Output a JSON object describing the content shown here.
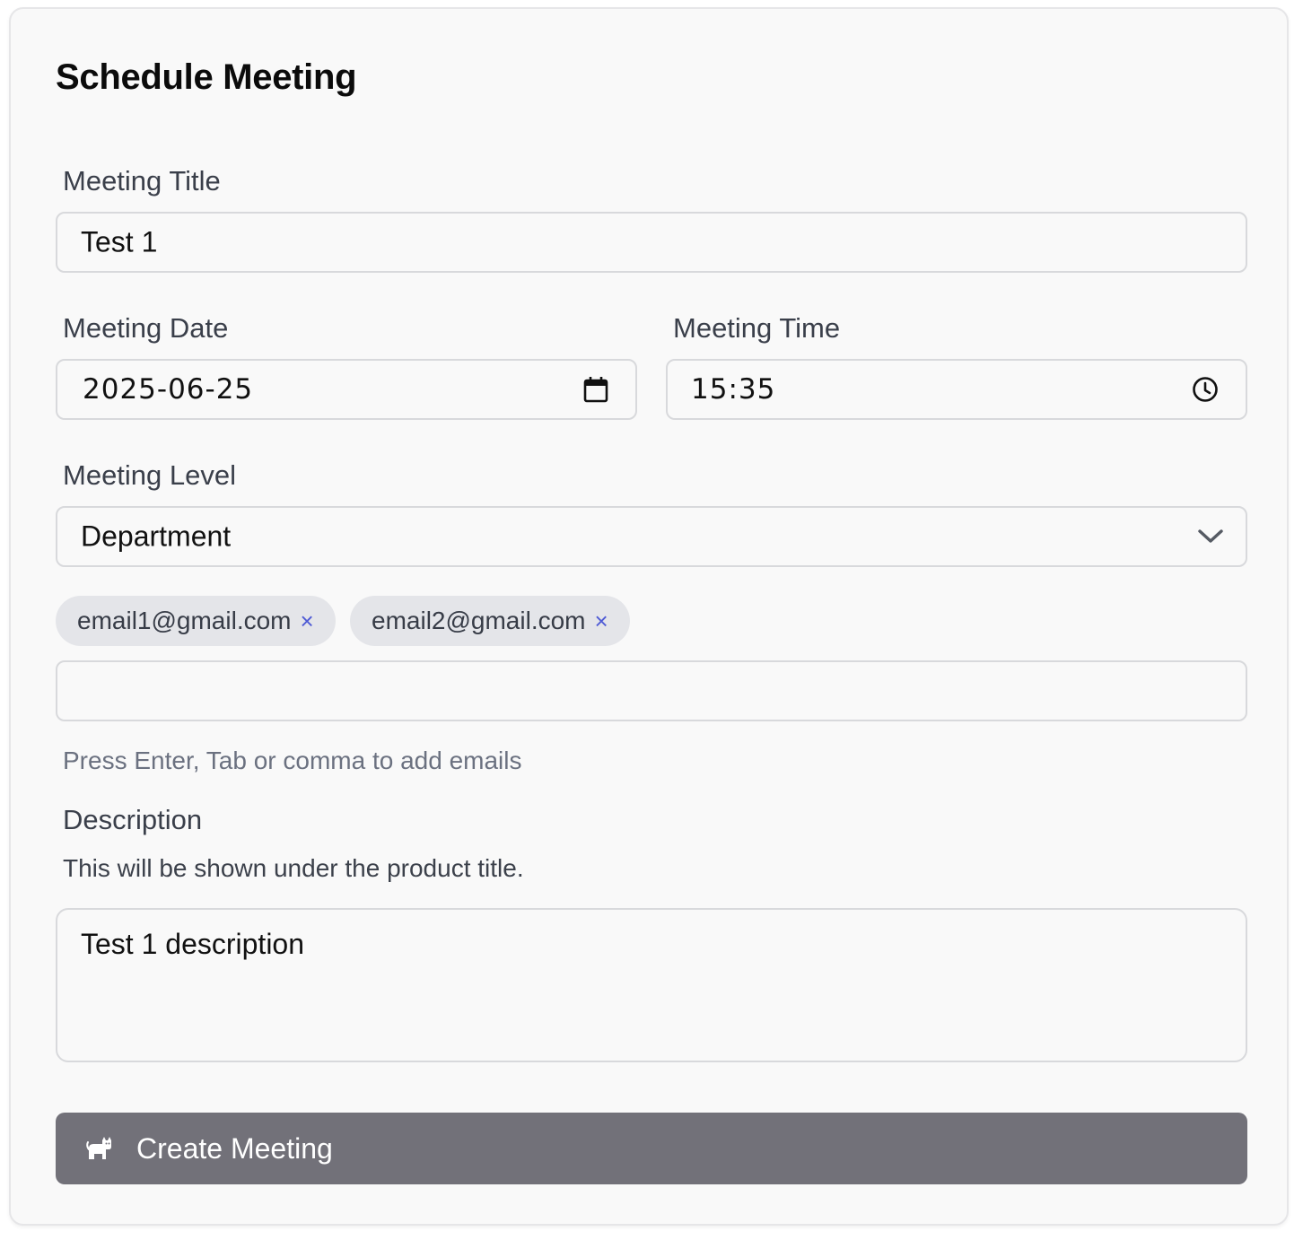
{
  "form": {
    "title": "Schedule Meeting",
    "meeting_title": {
      "label": "Meeting Title",
      "value": "Test 1"
    },
    "meeting_date": {
      "label": "Meeting Date",
      "value": "2025-06-25",
      "icon": "calendar-icon"
    },
    "meeting_time": {
      "label": "Meeting Time",
      "value": "15:35",
      "icon": "clock-icon"
    },
    "meeting_level": {
      "label": "Meeting Level",
      "selected": "Department",
      "icon": "chevron-down-icon"
    },
    "emails": {
      "chips": [
        {
          "text": "email1@gmail.com",
          "remove": "×"
        },
        {
          "text": "email2@gmail.com",
          "remove": "×"
        }
      ],
      "input_value": "",
      "hint": "Press Enter, Tab or comma to add emails"
    },
    "description": {
      "label": "Description",
      "subtitle": "This will be shown under the product title.",
      "value": "Test 1 description"
    },
    "submit": {
      "label": "Create Meeting",
      "icon": "cat-icon"
    }
  },
  "colors": {
    "card_bg": "#f9f9f9",
    "border": "#d8d9dc",
    "chip_bg": "#e4e5e9",
    "chip_remove": "#4f5bd5",
    "button_bg": "#727179",
    "hint_text": "#6b7180"
  }
}
